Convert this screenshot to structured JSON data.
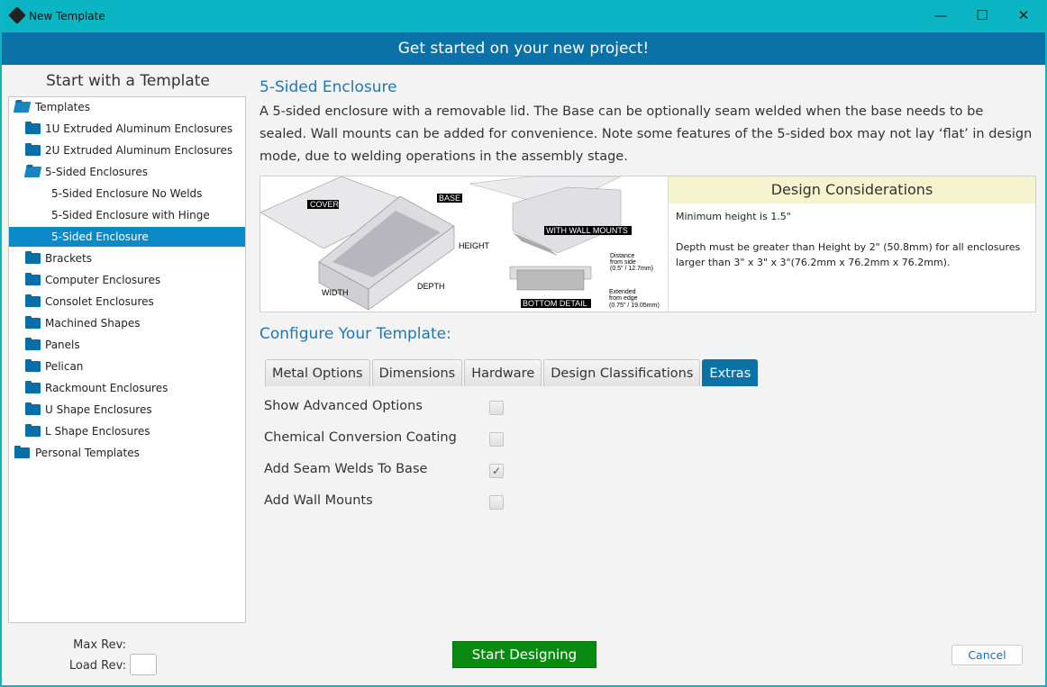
{
  "window": {
    "title": "New Template",
    "minimize": "—",
    "maximize": "☐",
    "close": "✕"
  },
  "banner": "Get started on your new project!",
  "left": {
    "heading": "Start with a Template",
    "max_rev_label": "Max Rev:",
    "load_rev_label": "Load Rev:",
    "load_rev_value": ""
  },
  "tree": [
    {
      "label": "Templates",
      "level": 0,
      "icon": "folder-open-icon"
    },
    {
      "label": "1U Extruded Aluminum Enclosures",
      "level": 1,
      "icon": "folder-icon"
    },
    {
      "label": "2U Extruded Aluminum Enclosures",
      "level": 1,
      "icon": "folder-icon"
    },
    {
      "label": "5-Sided Enclosures",
      "level": 1,
      "icon": "folder-open-icon"
    },
    {
      "label": "5-Sided Enclosure No Welds",
      "level": 2
    },
    {
      "label": "5-Sided Enclosure with Hinge",
      "level": 2
    },
    {
      "label": "5-Sided Enclosure",
      "level": 2,
      "selected": true
    },
    {
      "label": "Brackets",
      "level": 1,
      "icon": "folder-icon"
    },
    {
      "label": "Computer Enclosures",
      "level": 1,
      "icon": "folder-icon"
    },
    {
      "label": "Consolet Enclosures",
      "level": 1,
      "icon": "folder-icon"
    },
    {
      "label": "Machined Shapes",
      "level": 1,
      "icon": "folder-icon"
    },
    {
      "label": "Panels",
      "level": 1,
      "icon": "folder-icon"
    },
    {
      "label": "Pelican",
      "level": 1,
      "icon": "folder-icon"
    },
    {
      "label": "Rackmount Enclosures",
      "level": 1,
      "icon": "folder-icon"
    },
    {
      "label": "U Shape Enclosures",
      "level": 1,
      "icon": "folder-icon"
    },
    {
      "label": "L Shape Enclosures",
      "level": 1,
      "icon": "folder-icon"
    },
    {
      "label": "Personal Templates",
      "level": 0,
      "icon": "folder-icon"
    }
  ],
  "template": {
    "title": "5-Sided Enclosure",
    "description": "A 5-sided enclosure with a removable lid. The Base can be optionally seam welded when the base needs to be sealed. Wall mounts can be added for convenience. Note some features of the 5-sided box may not lay ‘flat’ in design mode, due to welding operations in the assembly stage.",
    "image_labels": {
      "cover": "COVER",
      "base": "BASE",
      "height": "HEIGHT",
      "width": "WIDTH",
      "depth": "DEPTH",
      "wall": "WITH WALL MOUNTS",
      "bottom": "BOTTOM DETAIL",
      "dist1": "Distance",
      "dist2": "from side",
      "dist3": "(0.5\" / 12.7mm)",
      "ext1": "Extended",
      "ext2": "from edge",
      "ext3": "(0.75\" / 19.05mm)"
    },
    "considerations_title": "Design Considerations",
    "considerations": [
      "Minimum height is 1.5\"",
      "Depth must be greater than Height by 2\" (50.8mm) for all enclosures larger than 3\" x 3\" x 3\"(76.2mm x 76.2mm x 76.2mm)."
    ]
  },
  "configure": {
    "heading": "Configure Your Template:",
    "tabs": [
      {
        "label": "Metal Options"
      },
      {
        "label": "Dimensions"
      },
      {
        "label": "Hardware"
      },
      {
        "label": "Design Classifications"
      },
      {
        "label": "Extras",
        "active": true
      }
    ],
    "options": [
      {
        "label": "Show Advanced Options",
        "checked": false
      },
      {
        "label": "Chemical Conversion Coating",
        "checked": false
      },
      {
        "label": "Add Seam Welds To Base",
        "checked": true
      },
      {
        "label": "Add Wall Mounts",
        "checked": false
      }
    ]
  },
  "buttons": {
    "start": "Start Designing",
    "cancel": "Cancel"
  },
  "colors": {
    "titlebar": "#0cb5c3",
    "banner": "#0a72a6",
    "selected": "#0a8ac6",
    "start": "#0b8a12",
    "accent": "#1f78b4"
  }
}
